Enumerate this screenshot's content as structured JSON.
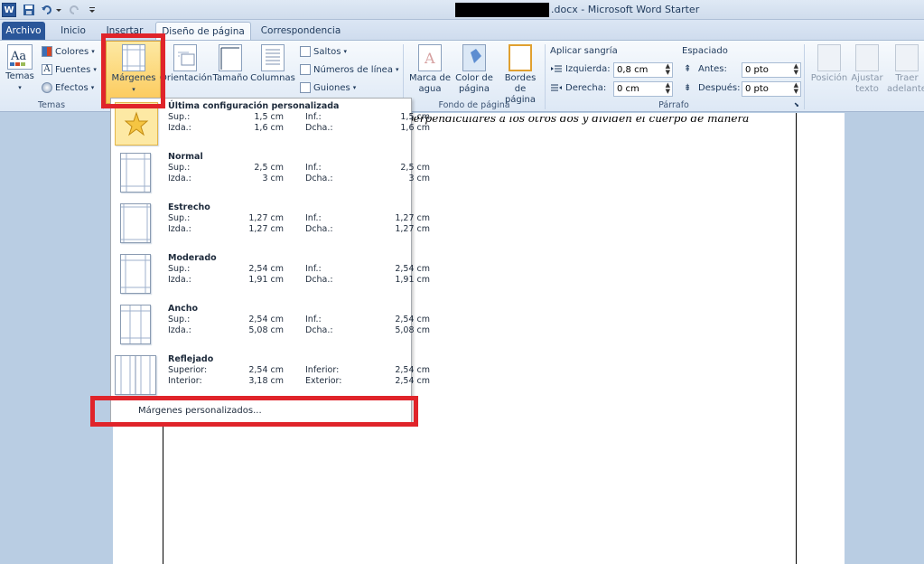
{
  "window": {
    "title_suffix": ".docx - Microsoft Word Starter",
    "app_icon": "W"
  },
  "qat": {
    "save": "save-icon",
    "undo": "undo-icon",
    "redo": "redo-icon"
  },
  "tabs": [
    "Archivo",
    "Inicio",
    "Insertar",
    "Diseño de página",
    "Correspondencia"
  ],
  "ribbon": {
    "temas": {
      "group": "Temas",
      "temas_btn": "Temas",
      "colores": "Colores",
      "fuentes": "Fuentes",
      "efectos": "Efectos"
    },
    "config": {
      "margenes": "Márgenes",
      "orientacion": "Orientación",
      "tamano": "Tamaño",
      "columnas": "Columnas",
      "saltos": "Saltos",
      "numeros": "Números de línea",
      "guiones": "Guiones"
    },
    "fondo": {
      "group": "Fondo de página",
      "marca1": "Marca de",
      "marca2": "agua",
      "color1": "Color de",
      "color2": "página",
      "bordes1": "Bordes",
      "bordes2": "de página"
    },
    "parrafo": {
      "group": "Párrafo",
      "sangria": "Aplicar sangría",
      "izquierda": "Izquierda:",
      "izquierda_val": "0,8 cm",
      "derecha": "Derecha:",
      "derecha_val": "0 cm",
      "espaciado": "Espaciado",
      "antes": "Antes:",
      "antes_val": "0 pto",
      "despues": "Después:",
      "despues_val": "0 pto"
    },
    "organizar": {
      "posicion": "Posición",
      "ajustar1": "Ajustar",
      "ajustar2": "texto",
      "traer1": "Traer",
      "traer2": "adelante"
    }
  },
  "document": {
    "visible_text": "perpendiculares a los otros dos y dividen el cuerpo de manera"
  },
  "menu": {
    "presets": [
      {
        "name": "Última configuración personalizada",
        "l1": "Sup.:",
        "v1": "1,5 cm",
        "l2": "Inf.:",
        "v2": "1,5 cm",
        "l3": "Izda.:",
        "v3": "1,6 cm",
        "l4": "Dcha.:",
        "v4": "1,6 cm"
      },
      {
        "name": "Normal",
        "l1": "Sup.:",
        "v1": "2,5 cm",
        "l2": "Inf.:",
        "v2": "2,5 cm",
        "l3": "Izda.:",
        "v3": "3 cm",
        "l4": "Dcha.:",
        "v4": "3 cm"
      },
      {
        "name": "Estrecho",
        "l1": "Sup.:",
        "v1": "1,27 cm",
        "l2": "Inf.:",
        "v2": "1,27 cm",
        "l3": "Izda.:",
        "v3": "1,27 cm",
        "l4": "Dcha.:",
        "v4": "1,27 cm"
      },
      {
        "name": "Moderado",
        "l1": "Sup.:",
        "v1": "2,54 cm",
        "l2": "Inf.:",
        "v2": "2,54 cm",
        "l3": "Izda.:",
        "v3": "1,91 cm",
        "l4": "Dcha.:",
        "v4": "1,91 cm"
      },
      {
        "name": "Ancho",
        "l1": "Sup.:",
        "v1": "2,54 cm",
        "l2": "Inf.:",
        "v2": "2,54 cm",
        "l3": "Izda.:",
        "v3": "5,08 cm",
        "l4": "Dcha.:",
        "v4": "5,08 cm"
      },
      {
        "name": "Reflejado",
        "l1": "Superior:",
        "v1": "2,54 cm",
        "l2": "Inferior:",
        "v2": "2,54 cm",
        "l3": "Interior:",
        "v3": "3,18 cm",
        "l4": "Exterior:",
        "v4": "2,54 cm"
      }
    ],
    "custom": "Márgenes personalizados..."
  },
  "colors": {
    "highlight": "#e0242a",
    "archivo_tab": "#2a5699"
  }
}
